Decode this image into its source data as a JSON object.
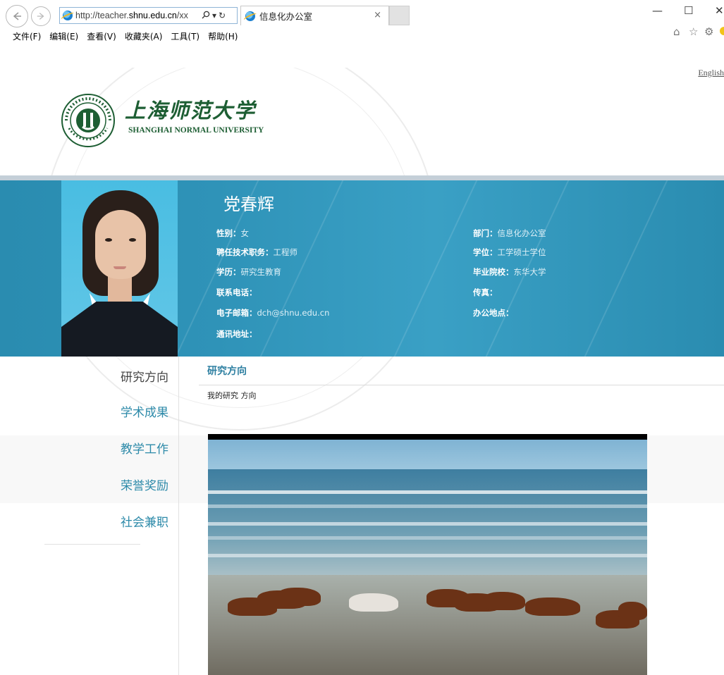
{
  "browser": {
    "url_prefix": "http://teacher.",
    "url_host": "shnu.edu.cn",
    "url_suffix": "/xx",
    "search_icon": "search-icon",
    "dropdown_glyph": "▾",
    "refresh_glyph": "↻",
    "tab_title": "信息化办公室",
    "tab_close": "×",
    "window": {
      "minimize": "—",
      "maximize": "☐",
      "close": "✕"
    },
    "tools": {
      "home": "⌂",
      "favorites": "☆",
      "settings": "⚙"
    }
  },
  "menubar": [
    "文件(F)",
    "编辑(E)",
    "查看(V)",
    "收藏夹(A)",
    "工具(T)",
    "帮助(H)"
  ],
  "header": {
    "english_link": "English",
    "university_cn": "上海师范大学",
    "university_en": "SHANGHAI NORMAL UNIVERSITY"
  },
  "profile": {
    "name": "党春辉",
    "left": [
      {
        "key": "性别：",
        "value": "女"
      },
      {
        "key": "聘任技术职务：",
        "value": "工程师"
      },
      {
        "key": "学历：",
        "value": "研究生教育"
      },
      {
        "key": "联系电话：",
        "value": ""
      },
      {
        "key": "电子邮箱：",
        "value": "dch@shnu.edu.cn"
      },
      {
        "key": "通讯地址：",
        "value": ""
      }
    ],
    "right": [
      {
        "key": "部门：",
        "value": "信息化办公室"
      },
      {
        "key": "学位：",
        "value": "工学硕士学位"
      },
      {
        "key": "毕业院校：",
        "value": "东华大学"
      },
      {
        "key": "传真：",
        "value": ""
      },
      {
        "key": "办公地点：",
        "value": ""
      }
    ]
  },
  "sidenav": [
    "研究方向",
    "学术成果",
    "教学工作",
    "荣誉奖励",
    "社会兼职"
  ],
  "content": {
    "title": "研究方向",
    "text": "我的研究 方向"
  },
  "colors": {
    "banner": "#2f93b8",
    "nav_link": "#2d8aa9",
    "logo_green": "#1d5e33"
  }
}
